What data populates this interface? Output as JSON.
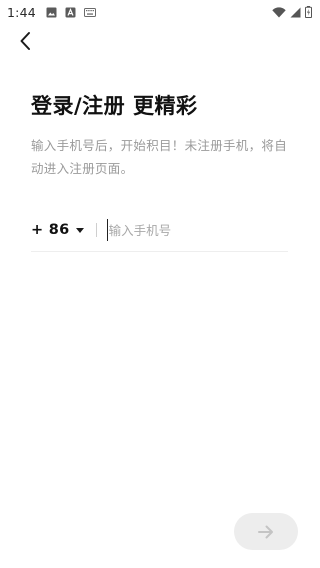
{
  "status_bar": {
    "time": "1:44",
    "icons": [
      "image-icon",
      "app-store-icon",
      "keyboard-icon",
      "wifi-icon",
      "signal-icon",
      "battery-icon"
    ]
  },
  "nav": {
    "back_icon": "chevron-left-icon"
  },
  "login": {
    "title": "登录/注册 更精彩",
    "subtitle": "输入手机号后，开始积目！未注册手机，将自动进入注册页面。",
    "country_code": "+ 86",
    "phone_placeholder": "输入手机号",
    "phone_value": "",
    "next_icon": "arrow-right-icon"
  },
  "colors": {
    "text_primary": "#111111",
    "text_secondary": "#9a9a9a",
    "next_button_bg": "#ededed",
    "next_icon": "#c4c4c4"
  }
}
